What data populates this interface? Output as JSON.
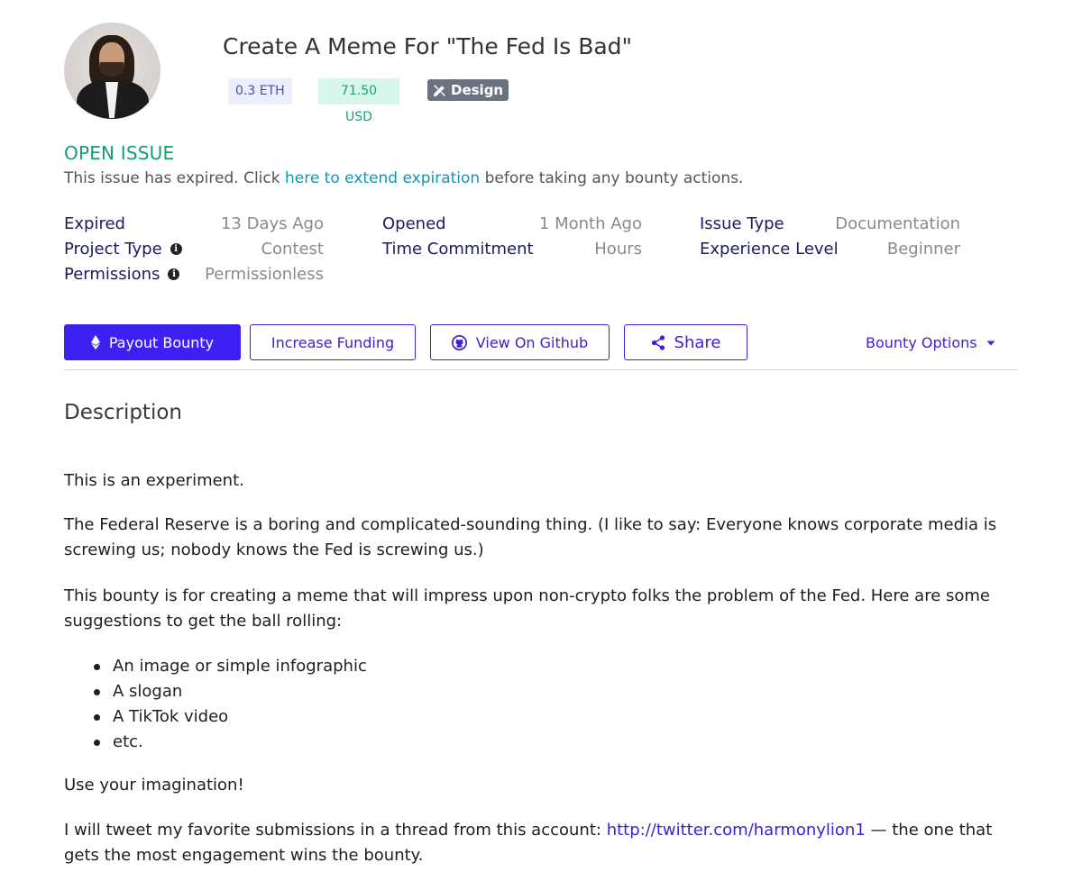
{
  "bounty": {
    "title": "Create A Meme For \"The Fed Is Bad\"",
    "amount_eth": "0.3 ETH",
    "amount_usd": "71.50 USD",
    "category": "Design",
    "status": "OPEN ISSUE",
    "expired_notice": {
      "before": "This issue has expired. Click ",
      "link": "here to extend expiration",
      "after": " before taking any bounty actions."
    }
  },
  "meta": {
    "expired_label": "Expired",
    "expired_value": "13 Days Ago",
    "opened_label": "Opened",
    "opened_value": "1 Month Ago",
    "issue_type_label": "Issue Type",
    "issue_type_value": "Documentation",
    "project_type_label": "Project Type",
    "project_type_value": "Contest",
    "time_commitment_label": "Time Commitment",
    "time_commitment_value": "Hours",
    "experience_level_label": "Experience Level",
    "experience_level_value": "Beginner",
    "permissions_label": "Permissions",
    "permissions_value": "Permissionless"
  },
  "actions": {
    "payout": "Payout Bounty",
    "increase": "Increase Funding",
    "github": "View On Github",
    "share": "Share",
    "options": "Bounty Options"
  },
  "description": {
    "heading": "Description",
    "p1": "This is an experiment.",
    "p2": "The Federal Reserve is a boring and complicated-sounding thing. (I like to say: Everyone knows corporate media is screwing us; nobody knows the Fed is screwing us.)",
    "p3": "This bounty is for creating a meme that will impress upon non-crypto folks the problem of the Fed. Here are some suggestions to get the ball rolling:",
    "bullets": [
      "An image or simple infographic",
      "A slogan",
      "A TikTok video",
      "etc."
    ],
    "p4": "Use your imagination!",
    "p5_before": "I will tweet my favorite submissions in a thread from this account: ",
    "p5_link": "http://twitter.com/harmonylion1",
    "p5_after": " — the one that gets the most engagement wins the bounty."
  },
  "colors": {
    "accent": "#3d21f2",
    "status_green": "#0fa36b",
    "link_teal": "#1396b5",
    "label_navy": "#1b1b5e"
  }
}
